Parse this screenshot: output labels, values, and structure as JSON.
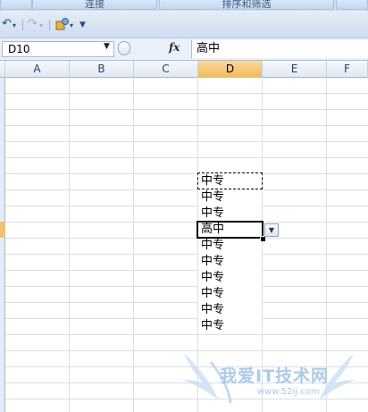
{
  "ribbon": {
    "groups": [
      {
        "label": ""
      },
      {
        "label": "连接"
      },
      {
        "label": "排序和筛选"
      },
      {
        "label": ""
      }
    ]
  },
  "qat": {
    "icons": [
      "undo-icon",
      "redo-icon",
      "macro-icon",
      "customize-icon"
    ]
  },
  "formula_bar": {
    "name_box": "D10",
    "fx_label": "fx",
    "value": "高中"
  },
  "columns": [
    "A",
    "B",
    "C",
    "D",
    "E",
    "F"
  ],
  "active_column": "D",
  "column_d_cells": [
    {
      "value": "中专"
    },
    {
      "value": "中专"
    },
    {
      "value": "中专"
    },
    {
      "value": "高中"
    },
    {
      "value": "中专"
    },
    {
      "value": "中专"
    },
    {
      "value": "中专"
    },
    {
      "value": "中专"
    },
    {
      "value": "中专"
    },
    {
      "value": "中专"
    }
  ],
  "watermark": {
    "text": "我爱IT技术网",
    "url": "www.52ij.com"
  },
  "colors": {
    "header_active": "#f4c06b",
    "gridline": "#d8dfe8",
    "ribbon_blue": "#cfdff2"
  }
}
